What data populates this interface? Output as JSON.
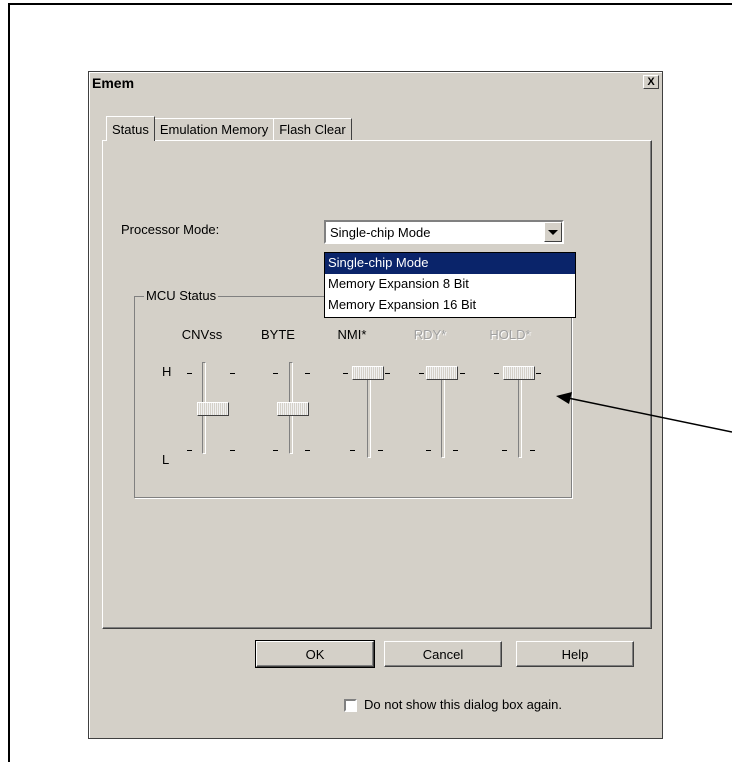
{
  "window": {
    "title": "Emem",
    "close_symbol": "X"
  },
  "tabs": [
    {
      "label": "Status"
    },
    {
      "label": "Emulation Memory"
    },
    {
      "label": "Flash Clear"
    }
  ],
  "status_tab": {
    "processor_mode": {
      "label": "Processor Mode:",
      "selected": "Single-chip Mode",
      "options": [
        "Single-chip Mode",
        "Memory Expansion 8 Bit",
        "Memory Expansion 16 Bit"
      ],
      "highlighted_index": 0,
      "expanded": true
    },
    "mcu_status": {
      "group_label": "MCU Status",
      "high_label": "H",
      "low_label": "L",
      "sliders": [
        {
          "label": "CNVss",
          "level": "mid",
          "enabled": true
        },
        {
          "label": "BYTE",
          "level": "mid",
          "enabled": true
        },
        {
          "label": "NMI*",
          "level": "H",
          "enabled": true
        },
        {
          "label": "RDY*",
          "level": "H",
          "enabled": false
        },
        {
          "label": "HOLD*",
          "level": "H",
          "enabled": false
        }
      ]
    }
  },
  "buttons": {
    "ok": "OK",
    "cancel": "Cancel",
    "help": "Help"
  },
  "dont_show": {
    "label": "Do not show this dialog box again.",
    "checked": false
  },
  "colors": {
    "dialog_face": "#d4d0c8",
    "selection": "#0a246a",
    "disabled_text": "#a0a0a0"
  }
}
